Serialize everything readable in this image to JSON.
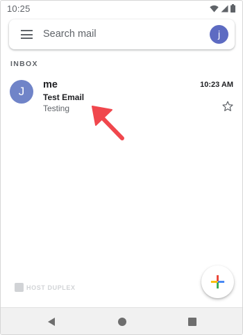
{
  "status_bar": {
    "time": "10:25",
    "icons": [
      "wifi-icon",
      "signal-icon",
      "battery-icon"
    ]
  },
  "search": {
    "menu_icon": "menu-icon",
    "placeholder": "Search mail",
    "account_initial": "j"
  },
  "section": {
    "label": "INBOX"
  },
  "mail": {
    "avatar_initial": "J",
    "sender": "me",
    "time": "10:23 AM",
    "subject": "Test Email",
    "snippet": "Testing",
    "star_icon": "star-outline-icon"
  },
  "watermark": {
    "text": "HOST DUPLEX"
  },
  "fab": {
    "icon": "compose-plus-icon"
  },
  "nav": {
    "icons": [
      "back-icon",
      "home-icon",
      "recents-icon"
    ]
  },
  "colors": {
    "avatar_account": "#5d6bc2",
    "avatar_sender": "#7084c8",
    "annotation_arrow": "#f0474d",
    "text_primary": "#202124",
    "text_secondary": "#5f6368"
  }
}
